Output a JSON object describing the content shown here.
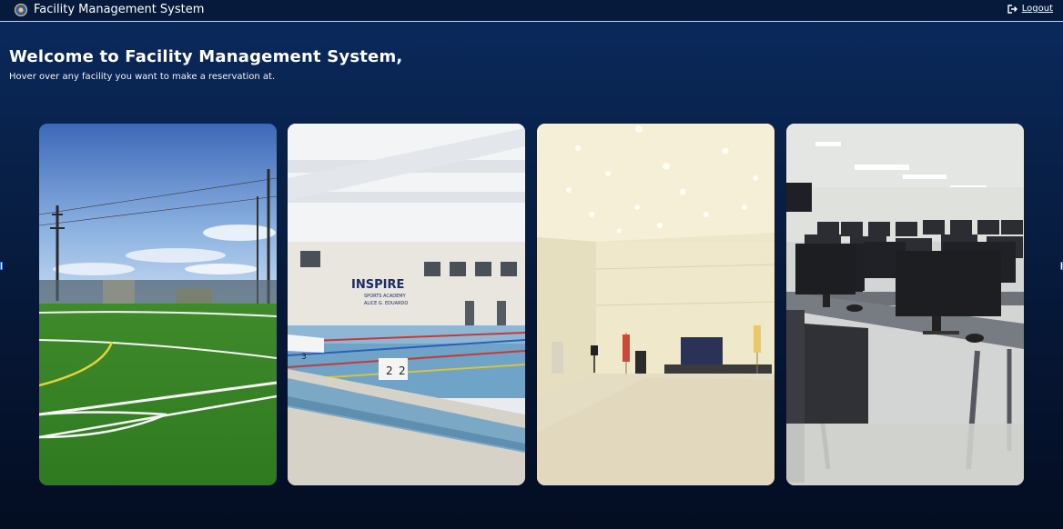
{
  "app": {
    "title": "Facility Management System"
  },
  "header": {
    "logout_label": "Logout"
  },
  "main": {
    "welcome": "Welcome to Facility Management System,",
    "instruction": "Hover over any facility you want to make a reservation at."
  },
  "facilities": [
    {
      "icon": "football-field-photo"
    },
    {
      "icon": "swimming-pool-photo",
      "signage": [
        "INSPIRE",
        "SPORTS ACADEMY",
        "ALICE G. EDUARDO"
      ],
      "lane_blocks": [
        "3",
        "2",
        "2"
      ]
    },
    {
      "icon": "function-hall-photo"
    },
    {
      "icon": "computer-laboratory-photo"
    }
  ],
  "colors": {
    "header_bg": "#061a3c",
    "page_bg_top": "#0a2a5e",
    "page_bg_bottom": "#040d22"
  }
}
